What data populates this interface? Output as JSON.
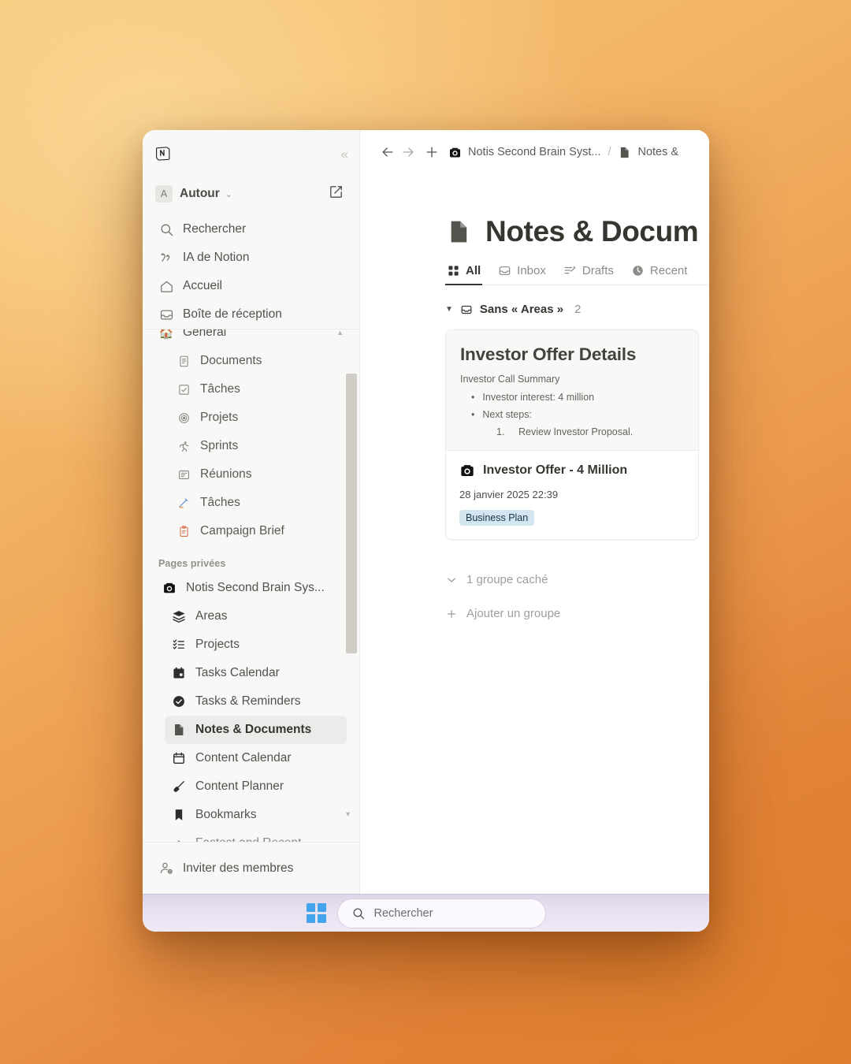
{
  "app": {
    "name": "Notion",
    "logo_icon": "notion-logo-icon"
  },
  "sidebar": {
    "collapse_icon": "«",
    "workspace": {
      "avatar_letter": "A",
      "name": "Autour",
      "caret": "⌄",
      "edit_icon": "compose-icon"
    },
    "nav": [
      {
        "label": "Rechercher",
        "icon": "search-icon"
      },
      {
        "label": "IA de Notion",
        "icon": "ai-sparkle-icon"
      },
      {
        "label": "Accueil",
        "icon": "home-icon"
      },
      {
        "label": "Boîte de réception",
        "icon": "inbox-icon"
      }
    ],
    "section": {
      "label": "General",
      "emoji": "🏠",
      "collapse_arrow": "▲",
      "children": [
        {
          "label": "Documents",
          "icon": "document-icon"
        },
        {
          "label": "Tâches",
          "icon": "checkbox-icon"
        },
        {
          "label": "Projets",
          "icon": "target-icon"
        },
        {
          "label": "Sprints",
          "icon": "runner-icon"
        },
        {
          "label": "Réunions",
          "icon": "meeting-icon"
        },
        {
          "label": "Tâches",
          "icon": "writing-hand-icon"
        },
        {
          "label": "Campaign Brief",
          "icon": "clipboard-icon"
        }
      ]
    },
    "private_group": {
      "title": "Pages privées",
      "items": [
        {
          "label": "Notis Second Brain Sys...",
          "icon": "camera-icon",
          "indent": false,
          "selected": false
        },
        {
          "label": "Areas",
          "icon": "layers-icon",
          "indent": true,
          "selected": false
        },
        {
          "label": "Projects",
          "icon": "checklist-icon",
          "indent": true,
          "selected": false
        },
        {
          "label": "Tasks Calendar",
          "icon": "calendar-icon",
          "indent": true,
          "selected": false
        },
        {
          "label": "Tasks & Reminders",
          "icon": "check-circle-icon",
          "indent": true,
          "selected": false
        },
        {
          "label": "Notes & Documents",
          "icon": "page-icon",
          "indent": true,
          "selected": true
        },
        {
          "label": "Content Calendar",
          "icon": "calendar-icon",
          "indent": true,
          "selected": false
        },
        {
          "label": "Content Planner",
          "icon": "paintbrush-icon",
          "indent": true,
          "selected": false
        },
        {
          "label": "Bookmarks",
          "icon": "bookmark-icon",
          "indent": true,
          "selected": false
        }
      ],
      "expand_arrow": "▾"
    },
    "bottom": {
      "label": "Inviter des membres",
      "icon": "add-person-icon"
    }
  },
  "topbar": {
    "back_icon": "arrow-left-icon",
    "forward_icon": "arrow-right-icon",
    "new_icon": "plus-icon",
    "breadcrumb": [
      {
        "label": "Notis Second Brain Syst...",
        "icon": "camera-icon"
      },
      {
        "label": "Notes &",
        "icon": "page-icon"
      }
    ],
    "separator": "/"
  },
  "page": {
    "icon": "page-icon",
    "title": "Notes & Docum",
    "tabs": [
      {
        "label": "All",
        "icon": "grid-icon",
        "active": true
      },
      {
        "label": "Inbox",
        "icon": "inbox-icon",
        "active": false
      },
      {
        "label": "Drafts",
        "icon": "draft-icon",
        "active": false
      },
      {
        "label": "Recent",
        "icon": "clock-icon",
        "active": false
      }
    ]
  },
  "board": {
    "group": {
      "toggle": "▼",
      "icon": "inbox-icon",
      "name": "Sans « Areas »",
      "count": "2"
    },
    "card": {
      "preview_title": "Investor Offer Details",
      "preview_subtitle": "Investor Call Summary",
      "bullets": [
        {
          "bullet": "•",
          "text": "Investor interest: 4 million"
        },
        {
          "bullet": "•",
          "text": "Next steps:"
        }
      ],
      "numbered": [
        {
          "num": "1.",
          "text": "Review Investor Proposal."
        }
      ],
      "title": "Investor Offer - 4 Million",
      "title_icon": "camera-icon",
      "date": "28 janvier 2025 22:39",
      "tag": "Business Plan",
      "tag_color": "#d3e5ef"
    },
    "hidden_group": {
      "label": "1 groupe caché",
      "icon": "chevron-down-icon"
    },
    "add_group": {
      "label": "Ajouter un groupe",
      "icon": "plus-icon"
    }
  },
  "taskbar": {
    "start_icon": "windows-logo-icon",
    "search": {
      "icon": "search-icon",
      "placeholder": "Rechercher"
    }
  },
  "colors": {
    "accent": "#37352f",
    "sidebar_bg": "#f8f8f7",
    "tag_blue": "#d3e5ef",
    "desktop_gradient_start": "#f7c978",
    "desktop_gradient_end": "#d97a2f"
  }
}
